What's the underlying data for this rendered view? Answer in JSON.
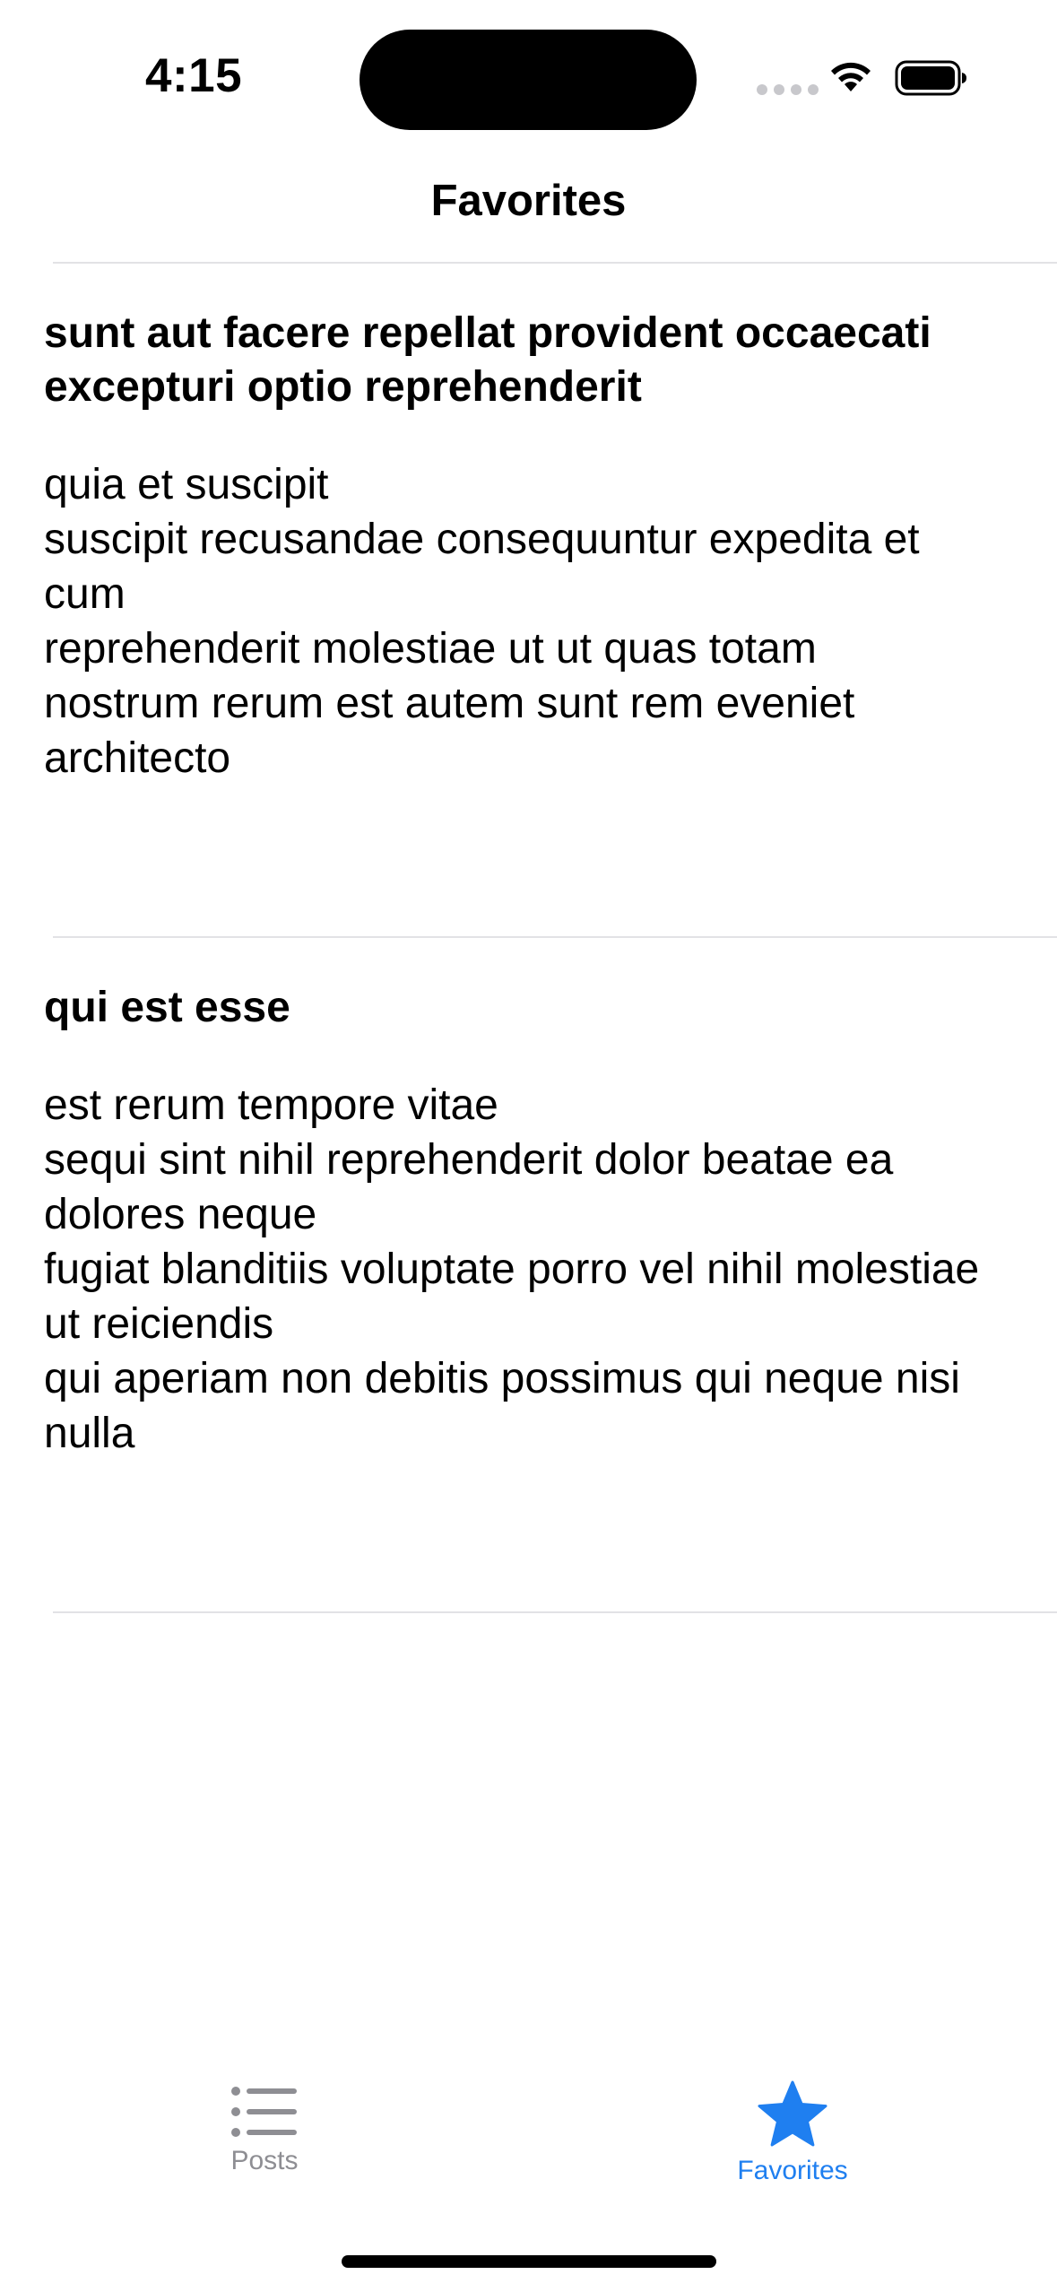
{
  "status_bar": {
    "time": "4:15"
  },
  "nav": {
    "title": "Favorites"
  },
  "posts": [
    {
      "title": "sunt aut facere repellat provident occaecati excepturi optio reprehenderit",
      "body": "quia et suscipit\nsuscipit recusandae consequuntur expedita et cum\nreprehenderit molestiae ut ut quas totam\nnostrum rerum est autem sunt rem eveniet architecto"
    },
    {
      "title": "qui est esse",
      "body": "est rerum tempore vitae\nsequi sint nihil reprehenderit dolor beatae ea dolores neque\nfugiat blanditiis voluptate porro vel nihil molestiae ut reiciendis\nqui aperiam non debitis possimus qui neque nisi nulla"
    }
  ],
  "tab_bar": {
    "items": [
      {
        "label": "Posts",
        "icon": "list-icon",
        "selected": false
      },
      {
        "label": "Favorites",
        "icon": "star-icon",
        "selected": true
      }
    ]
  },
  "colors": {
    "accent": "#1f7ff0",
    "inactive": "#8e8e93"
  }
}
